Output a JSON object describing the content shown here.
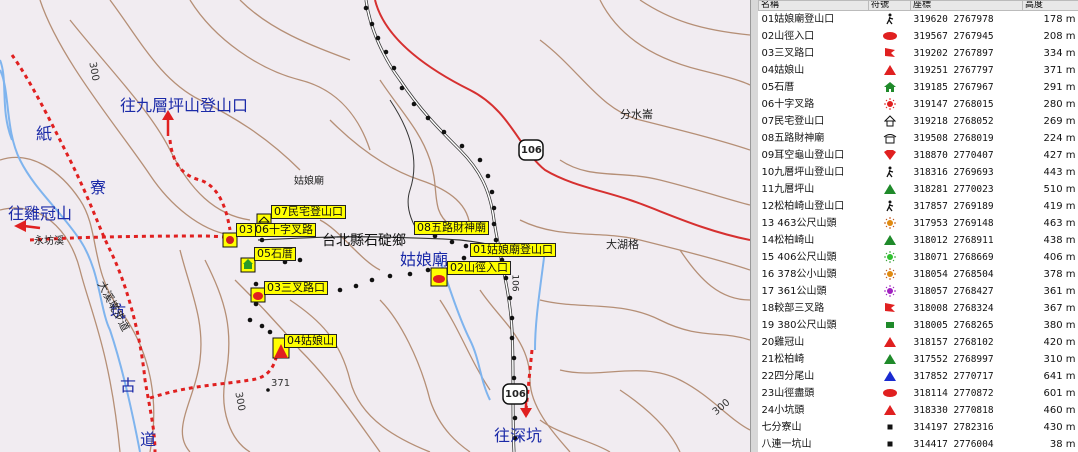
{
  "map": {
    "labels": {
      "jiugeng_trailhead": "往九層坪山登山口",
      "jiguan_mountain": "往雞冠山",
      "shenkeng": "往深坑",
      "paper": "紙",
      "liao": "寮",
      "keng": "坑",
      "gu": "古",
      "dao": "道",
      "guniang_place": "姑娘廟",
      "guniang_blue": "姑娘廟",
      "fenshui": "分水崙",
      "dahuge": "大湖格",
      "yongfangxi": "永坊溪",
      "county_road": "台北縣石碇鄉",
      "trail_name": "大溪墘步道",
      "contour_300a": "300",
      "contour_300b": "300",
      "contour_300c": "300",
      "contour_371": "371",
      "road_106a": "106",
      "road_106b": "106",
      "road_106c": "106"
    },
    "waypoints": {
      "wp07": "07民宅登山口",
      "wp06": "06十字叉路",
      "wp03a": "03",
      "wp05": "05石厝",
      "wp08": "08五路財神廟",
      "wp01": "01姑娘廟登山口",
      "wp02": "02山徑入口",
      "wp03": "03三叉路口",
      "wp04": "04姑娘山"
    }
  },
  "table": {
    "headers": {
      "name": "名稱",
      "symbol": "符號",
      "coords": "座標",
      "altitude": "高度"
    },
    "rows": [
      {
        "name": "01姑娘廟登山口",
        "icon": "hiker-icon",
        "coords": "319620 2767978",
        "alt": "178 m"
      },
      {
        "name": "02山徑入口",
        "icon": "red-ellipse-icon",
        "coords": "319567 2767945",
        "alt": "208 m"
      },
      {
        "name": "03三叉路口",
        "icon": "red-flag-icon",
        "coords": "319202 2767897",
        "alt": "334 m"
      },
      {
        "name": "04姑娘山",
        "icon": "red-triangle-icon",
        "coords": "319251 2767797",
        "alt": "371 m"
      },
      {
        "name": "05石厝",
        "icon": "green-house-icon",
        "coords": "319185 2767967",
        "alt": "291 m"
      },
      {
        "name": "06十字叉路",
        "icon": "red-sun-icon",
        "coords": "319147 2768015",
        "alt": "280 m"
      },
      {
        "name": "07民宅登山口",
        "icon": "house-outline-icon",
        "coords": "319218 2768052",
        "alt": "269 m"
      },
      {
        "name": "08五路財神廟",
        "icon": "temple-icon",
        "coords": "319508 2768019",
        "alt": "224 m"
      },
      {
        "name": "09耳空龜山登山口",
        "icon": "red-diamond-icon",
        "coords": "318870 2770407",
        "alt": "427 m"
      },
      {
        "name": "10九層坪山登山口",
        "icon": "hiker-icon",
        "coords": "318316 2769693",
        "alt": "443 m"
      },
      {
        "name": "11九層坪山",
        "icon": "green-triangle-icon",
        "coords": "318281 2770023",
        "alt": "510 m"
      },
      {
        "name": "12松柏崎山登山口",
        "icon": "hiker-icon",
        "coords": "317857 2769189",
        "alt": "419 m"
      },
      {
        "name": "13 463公尺山頭",
        "icon": "orange-sun-icon",
        "coords": "317953 2769148",
        "alt": "463 m"
      },
      {
        "name": "14松柏崎山",
        "icon": "green-triangle-icon",
        "coords": "318012 2768911",
        "alt": "438 m"
      },
      {
        "name": "15 406公尺山頭",
        "icon": "green-sun-icon",
        "coords": "318071 2768669",
        "alt": "406 m"
      },
      {
        "name": "16 378公小山頭",
        "icon": "orange-sun-icon",
        "coords": "318054 2768504",
        "alt": "378 m"
      },
      {
        "name": "17 361公山頭",
        "icon": "purple-sun-icon",
        "coords": "318057 2768427",
        "alt": "361 m"
      },
      {
        "name": "18較部三叉路",
        "icon": "red-flag-icon",
        "coords": "318008 2768324",
        "alt": "367 m"
      },
      {
        "name": "19 380公尺山頭",
        "icon": "green-square-icon",
        "coords": "318005 2768265",
        "alt": "380 m"
      },
      {
        "name": "20雞冠山",
        "icon": "red-triangle-icon",
        "coords": "318157 2768102",
        "alt": "420 m"
      },
      {
        "name": "21松柏崎",
        "icon": "green-triangle-icon",
        "coords": "317552 2768997",
        "alt": "310 m"
      },
      {
        "name": "22四分尾山",
        "icon": "blue-triangle-icon",
        "coords": "317852 2770717",
        "alt": "641 m"
      },
      {
        "name": "23山徑盡頭",
        "icon": "red-ellipse-icon",
        "coords": "318114 2770872",
        "alt": "601 m"
      },
      {
        "name": "24小坑頭",
        "icon": "red-triangle-icon",
        "coords": "318330 2770818",
        "alt": "460 m"
      },
      {
        "name": "七分寮山",
        "icon": "black-square-icon",
        "coords": "314197 2782316",
        "alt": "430 m"
      },
      {
        "name": "八連一坑山",
        "icon": "black-square-icon",
        "coords": "314417 2776004",
        "alt": "38 m"
      }
    ]
  }
}
